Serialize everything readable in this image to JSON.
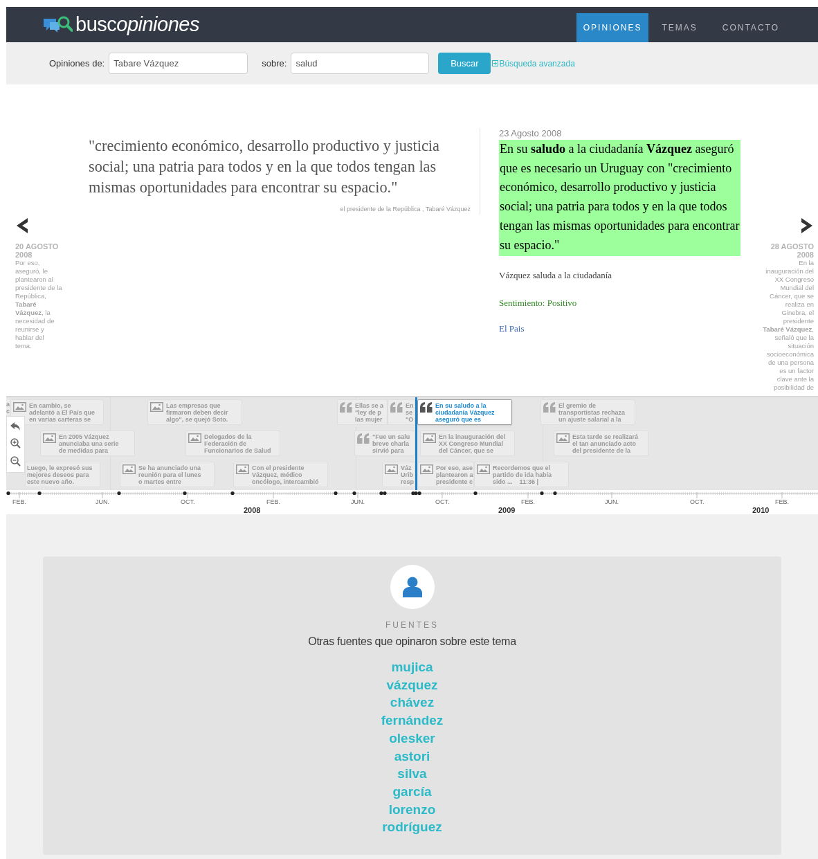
{
  "header": {
    "logo": {
      "plain": "busc",
      "emphasis": "opiniones"
    },
    "nav": [
      {
        "label": "OPINIONES",
        "selected": true
      },
      {
        "label": "TEMAS",
        "selected": false
      },
      {
        "label": "CONTACTO",
        "selected": false
      }
    ]
  },
  "search": {
    "author_label": "Opiniones de:",
    "author_value": "Tabare Vázquez",
    "topic_label": "sobre:",
    "topic_value": "salud",
    "submit": "Buscar",
    "advanced_link": "Búsqueda avanzada"
  },
  "previous": {
    "date": "20 AGOSTO 2008",
    "text": "Por eso, aseguró, le plantearon al presidente de la República, **Tabaré Vázquez**, la necesidad de reunirse y hablar del tema."
  },
  "quote": {
    "text": "\"crecimiento económico, desarrollo productivo y justicia social; una patria para todos y en la que todos tengan las mismas oportunidades para encontrar su espacio.\"",
    "attribution": "el presidente de la República , Tabaré Vázquez"
  },
  "article": {
    "date": "23 Agosto 2008",
    "text": "En su **saludo** a la ciudadanía **Vázquez** aseguró que es necesario un Uruguay con \"crecimiento económico, desarrollo productivo y justicia social; una patria para todos y en la que todos tengan las mismas oportunidades para encontrar su espacio.\"",
    "caption": "Vázquez saluda a la ciudadanía",
    "sentiment": "Sentimiento: Positivo",
    "source": "El Pais"
  },
  "next": {
    "date": "28 AGOSTO 2008",
    "text": "En la inauguración del XX Congreso Mundial del Cáncer, que se realiza en Ginebra, el presidente **Tabaré Vázquez**, señaló que la situación socioeconómica de una persona es un factor clave ante la posibilidad de"
  },
  "timeline": {
    "events": [
      {
        "kind": "text",
        "lines": [
          "a",
          "c"
        ],
        "selected": false
      },
      {
        "kind": "image",
        "lines": [
          "En cambio, se",
          "adelantó a El País que",
          "en varias carteras se"
        ],
        "selected": false
      },
      {
        "kind": "image",
        "lines": [
          "Las empresas que",
          "firmaron deben decir",
          "algo\", se quejó Soto."
        ],
        "selected": false
      },
      {
        "kind": "quote",
        "lines": [
          "Ellas se a",
          "\"ley de p",
          "las mujer"
        ],
        "selected": false
      },
      {
        "kind": "quote",
        "lines": [
          "En",
          "se",
          "\"O"
        ],
        "selected": false
      },
      {
        "kind": "quote",
        "lines": [
          "En su saludo a la",
          "ciudadanía Vázquez",
          "aseguró que es"
        ],
        "selected": true
      },
      {
        "kind": "quote",
        "lines": [
          "El gremio de",
          "transportistas rechaza",
          "un ajuste salarial a la"
        ],
        "selected": false
      },
      {
        "kind": "image",
        "lines": [
          "En 2005 Vázquez",
          "anunciaba una serie",
          "de medidas para"
        ],
        "selected": false
      },
      {
        "kind": "image",
        "lines": [
          "Delegados de la",
          "Federación de",
          "Funcionarios de Salud"
        ],
        "selected": false
      },
      {
        "kind": "quote",
        "lines": [
          "\"Fue un salu",
          "breve charla",
          "sirvió para"
        ],
        "selected": false
      },
      {
        "kind": "image",
        "lines": [
          "En la inauguración del",
          "XX Congreso Mundial",
          "del Cáncer, que se"
        ],
        "selected": false
      },
      {
        "kind": "image",
        "lines": [
          "Esta tarde se realizará",
          "el tan anunciado acto",
          "del presidente de la"
        ],
        "selected": false
      },
      {
        "kind": "text",
        "lines": [
          "Luego, le expresó sus",
          "mejores deseos para",
          "este nuevo año."
        ],
        "selected": false
      },
      {
        "kind": "image",
        "lines": [
          "Se ha anunciado una",
          "reunión para el lunes",
          "o martes entre"
        ],
        "selected": false
      },
      {
        "kind": "image",
        "lines": [
          "Con el presidente",
          "Vázquez, médico",
          "oncólogo, intercambió"
        ],
        "selected": false
      },
      {
        "kind": "image",
        "lines": [
          "Váz",
          "Urib",
          "resp"
        ],
        "selected": false
      },
      {
        "kind": "image",
        "lines": [
          "Por eso, ase",
          "plantearon a",
          "presidente c"
        ],
        "selected": false
      },
      {
        "kind": "image",
        "lines": [
          "Recordemos que el",
          "partido de ida había",
          "sido ...    11:36 |"
        ],
        "selected": false
      }
    ],
    "months": [
      "FEB.",
      "JUN.",
      "OCT.",
      "FEB.",
      "JUN.",
      "OCT.",
      "FEB.",
      "JUN.",
      "OCT.",
      "FEB."
    ],
    "years": [
      "2008",
      "2009",
      "2010"
    ]
  },
  "sources": {
    "kicker": "FUENTES",
    "title": "Otras fuentes que opinaron sobre este tema",
    "names": [
      "mujica",
      "vázquez",
      "chávez",
      "fernández",
      "olesker",
      "astori",
      "silva",
      "garcía",
      "lorenzo",
      "rodríguez"
    ]
  }
}
